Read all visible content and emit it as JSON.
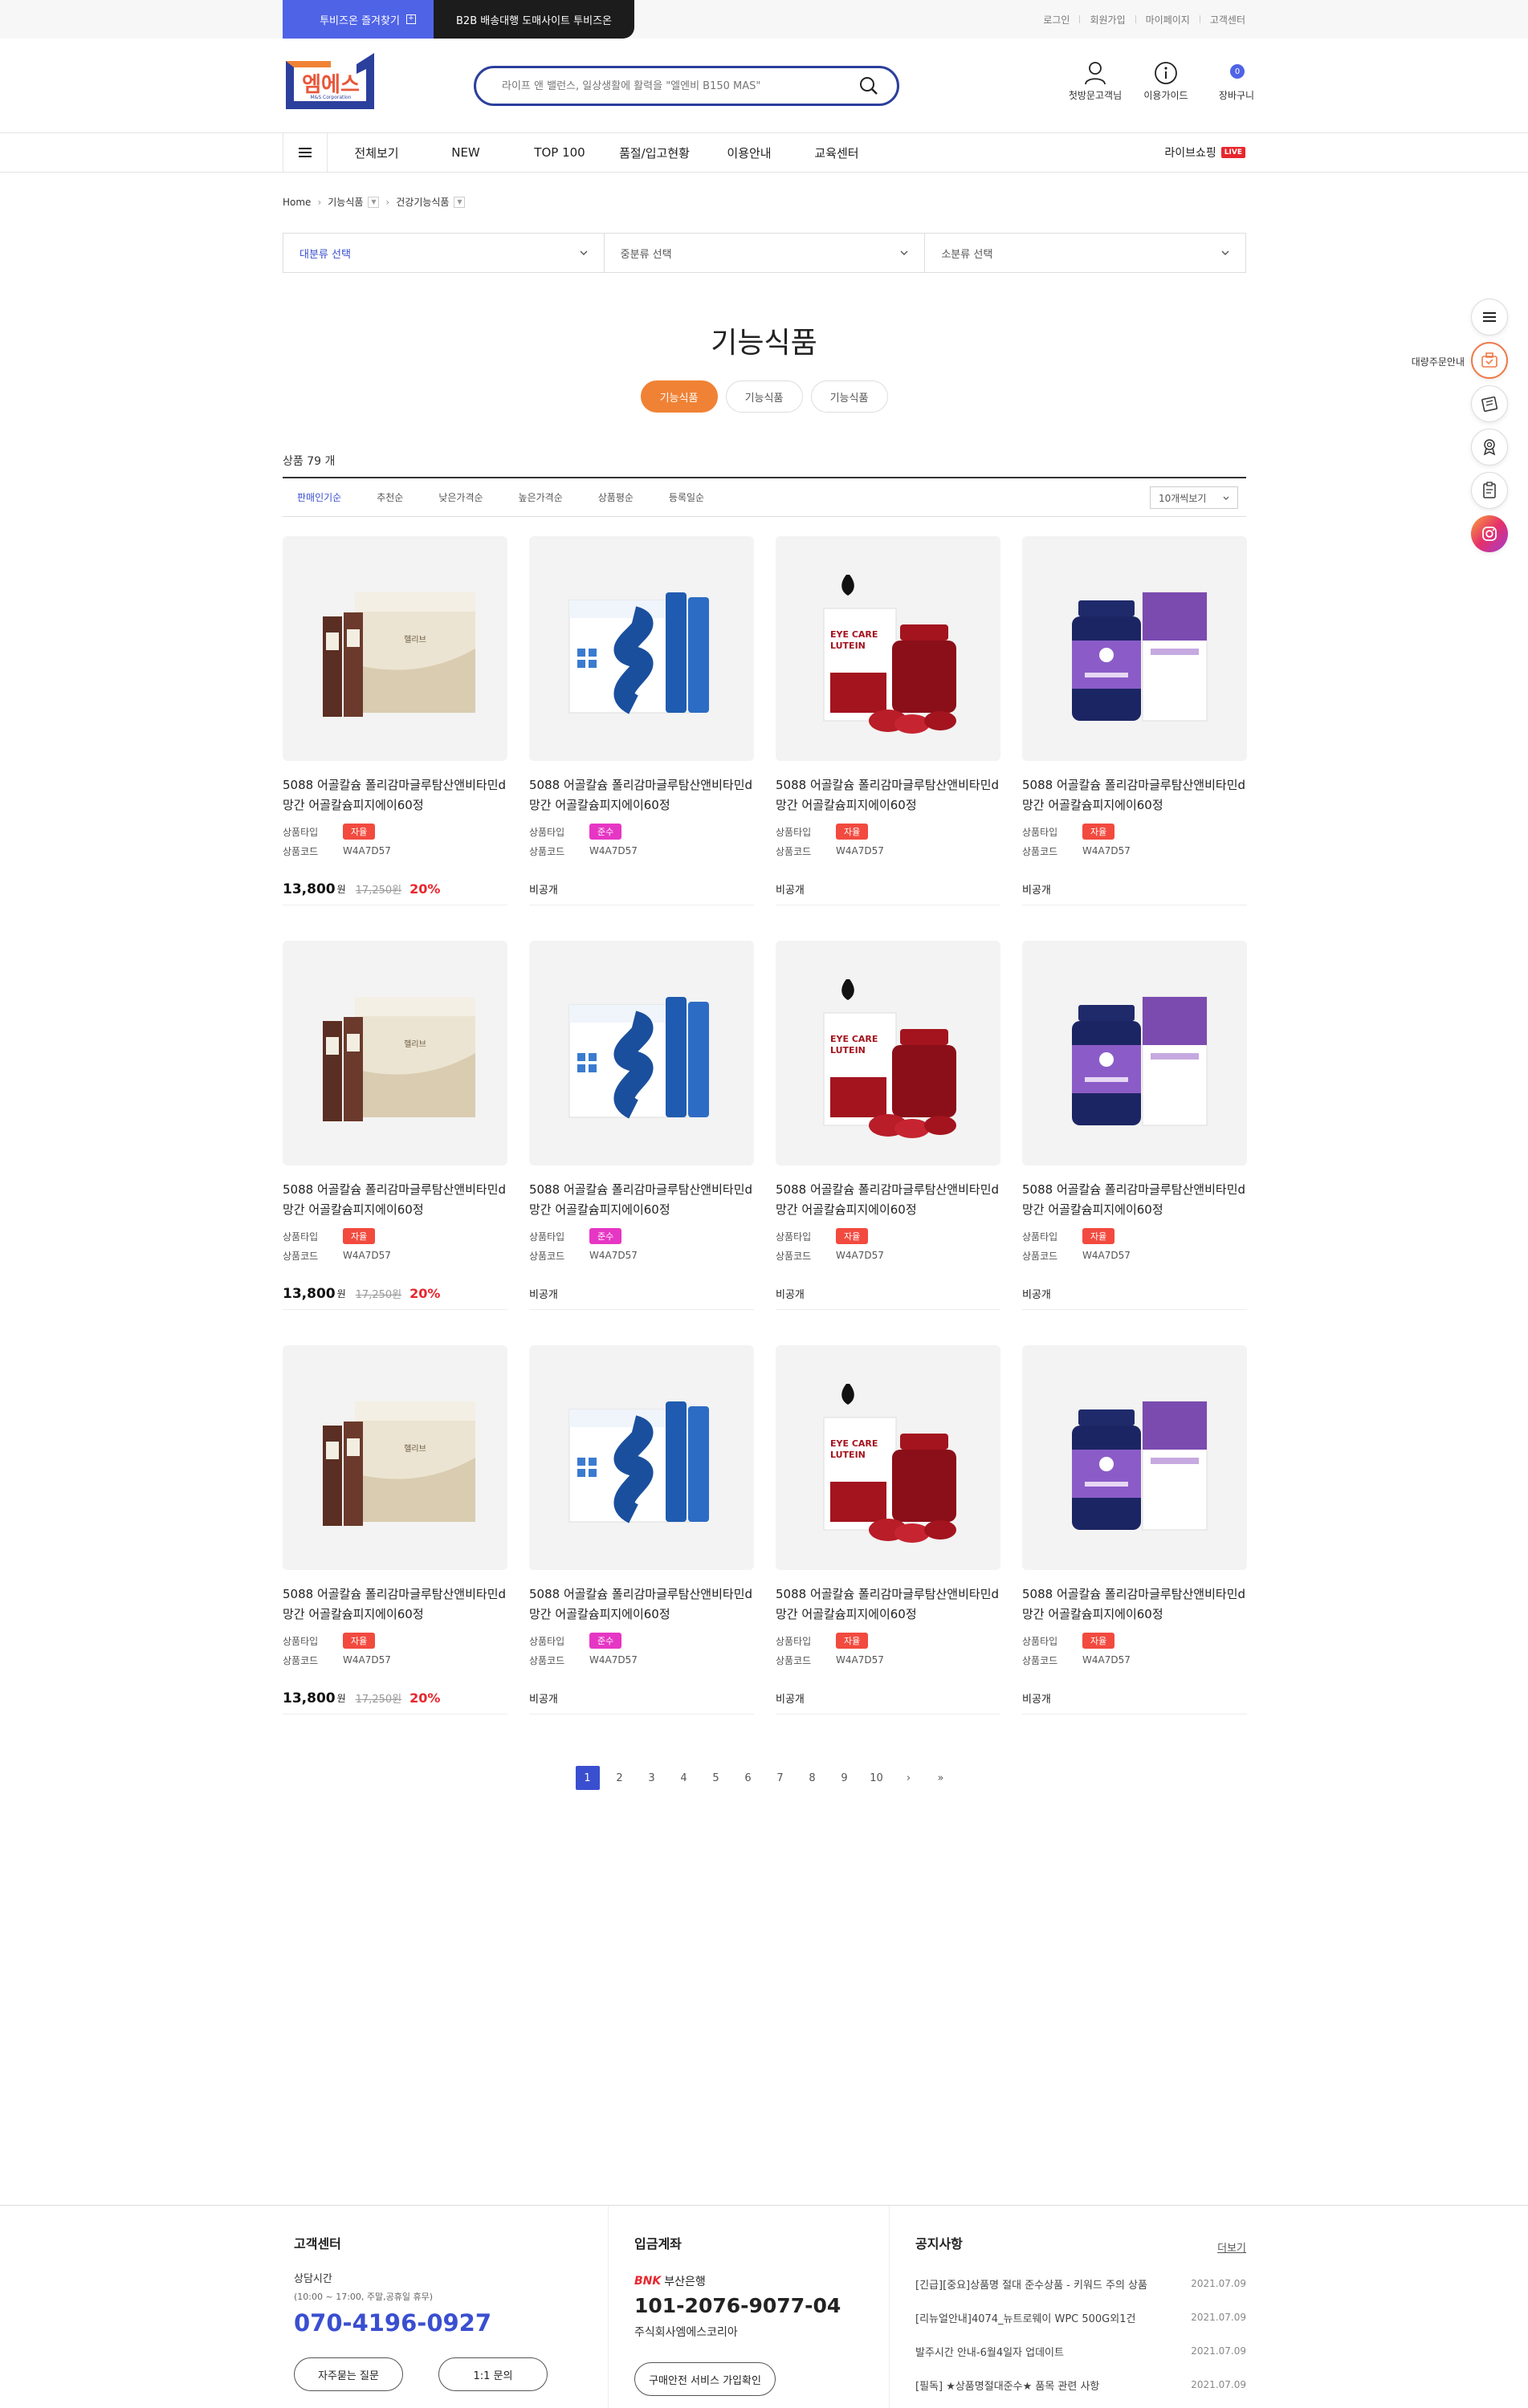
{
  "topbar": {
    "tab_business": "투비즈온 즐겨찾기",
    "tab_b2b": "B2B 배송대행 도매사이트 투비즈온",
    "links": [
      "로그인",
      "회원가입",
      "마이페이지",
      "고객센터"
    ]
  },
  "header": {
    "logo_text": "엠에스",
    "logo_sub": "M&S Corporation",
    "search_placeholder": "라이프 앤 밸런스, 일상생활에 활력을 \"엘엔비 B150 MAS\"",
    "icons": [
      {
        "label": "첫방문고객님",
        "icon": "user-icon"
      },
      {
        "label": "이용가이드",
        "icon": "info-icon"
      },
      {
        "label": "장바구니",
        "icon": "cart-icon",
        "badge": "0"
      }
    ]
  },
  "nav": {
    "items": [
      "전체보기",
      "NEW",
      "TOP 100",
      "품절/입고현황",
      "이용안내",
      "교육센터"
    ],
    "live_label": "라이브쇼핑",
    "live_badge": "LIVE"
  },
  "breadcrumb": {
    "home": "Home",
    "level1": "기능식품",
    "level2": "건강기능식품"
  },
  "filters": [
    "대분류 선택",
    "중분류 선택",
    "소분류 선택"
  ],
  "page": {
    "title": "기능식품",
    "subtabs": [
      "기능식품",
      "기능식품",
      "기능식품"
    ],
    "count_label": "상품 79 개"
  },
  "sort": {
    "options": [
      "판매인기순",
      "추천순",
      "낮은가격순",
      "높은가격순",
      "상품평순",
      "등록일순"
    ],
    "view_select": "10개씩보기"
  },
  "product_labels": {
    "type": "상품타입",
    "code": "상품코드",
    "won": "원"
  },
  "products": [
    {
      "name": "5088 어골칼슘 폴리감마글루탐산앤비타민d 망간 어골칼슘피지에이60정",
      "type": "자율",
      "type_color": "red",
      "code": "W4A7D57",
      "price": "13,800",
      "orig": "17,250원",
      "disc": "20%",
      "image": "stick-box",
      "private": ""
    },
    {
      "name": "5088 어골칼슘 폴리감마글루탐산앤비타민d 망간 어골칼슘피지에이60정",
      "type": "준수",
      "type_color": "pink",
      "code": "W4A7D57",
      "price": "",
      "orig": "",
      "disc": "",
      "image": "probiotics-box",
      "private": "비공개"
    },
    {
      "name": "5088 어골칼슘 폴리감마글루탐산앤비타민d 망간 어골칼슘피지에이60정",
      "type": "자율",
      "type_color": "red",
      "code": "W4A7D57",
      "price": "",
      "orig": "",
      "disc": "",
      "image": "lutein-gummy",
      "private": "비공개"
    },
    {
      "name": "5088 어골칼슘 폴리감마글루탐산앤비타민d 망간 어골칼슘피지에이60정",
      "type": "자율",
      "type_color": "red",
      "code": "W4A7D57",
      "price": "",
      "orig": "",
      "disc": "",
      "image": "purple-bottle",
      "private": "비공개"
    },
    {
      "name": "5088 어골칼슘 폴리감마글루탐산앤비타민d 망간 어골칼슘피지에이60정",
      "type": "자율",
      "type_color": "red",
      "code": "W4A7D57",
      "price": "13,800",
      "orig": "17,250원",
      "disc": "20%",
      "image": "stick-box",
      "private": ""
    },
    {
      "name": "5088 어골칼슘 폴리감마글루탐산앤비타민d 망간 어골칼슘피지에이60정",
      "type": "준수",
      "type_color": "pink",
      "code": "W4A7D57",
      "price": "",
      "orig": "",
      "disc": "",
      "image": "probiotics-box",
      "private": "비공개"
    },
    {
      "name": "5088 어골칼슘 폴리감마글루탐산앤비타민d 망간 어골칼슘피지에이60정",
      "type": "자율",
      "type_color": "red",
      "code": "W4A7D57",
      "price": "",
      "orig": "",
      "disc": "",
      "image": "lutein-gummy",
      "private": "비공개"
    },
    {
      "name": "5088 어골칼슘 폴리감마글루탐산앤비타민d 망간 어골칼슘피지에이60정",
      "type": "자율",
      "type_color": "red",
      "code": "W4A7D57",
      "price": "",
      "orig": "",
      "disc": "",
      "image": "purple-bottle",
      "private": "비공개"
    },
    {
      "name": "5088 어골칼슘 폴리감마글루탐산앤비타민d 망간 어골칼슘피지에이60정",
      "type": "자율",
      "type_color": "red",
      "code": "W4A7D57",
      "price": "13,800",
      "orig": "17,250원",
      "disc": "20%",
      "image": "stick-box",
      "private": ""
    },
    {
      "name": "5088 어골칼슘 폴리감마글루탐산앤비타민d 망간 어골칼슘피지에이60정",
      "type": "준수",
      "type_color": "pink",
      "code": "W4A7D57",
      "price": "",
      "orig": "",
      "disc": "",
      "image": "probiotics-box",
      "private": "비공개"
    },
    {
      "name": "5088 어골칼슘 폴리감마글루탐산앤비타민d 망간 어골칼슘피지에이60정",
      "type": "자율",
      "type_color": "red",
      "code": "W4A7D57",
      "price": "",
      "orig": "",
      "disc": "",
      "image": "lutein-gummy",
      "private": "비공개"
    },
    {
      "name": "5088 어골칼슘 폴리감마글루탐산앤비타민d 망간 어골칼슘피지에이60정",
      "type": "자율",
      "type_color": "red",
      "code": "W4A7D57",
      "price": "",
      "orig": "",
      "disc": "",
      "image": "purple-bottle",
      "private": "비공개"
    }
  ],
  "pagination": {
    "pages": [
      "1",
      "2",
      "3",
      "4",
      "5",
      "6",
      "7",
      "8",
      "9",
      "10"
    ],
    "current": "1",
    "next": "›",
    "last": "»"
  },
  "quick_menu": {
    "label": "대량주문안내",
    "icons": [
      "menu-icon",
      "bulk-order-icon",
      "catalog-icon",
      "award-icon",
      "clipboard-icon",
      "instagram-icon"
    ]
  },
  "footer": {
    "cs_title": "고객센터",
    "hours_label": "상담시간",
    "hours": "(10:00 ~ 17:00, 주말,공휴일 휴무)",
    "phone": "070-4196-0927",
    "btn_faq": "자주묻는 질문",
    "btn_qna": "1:1 문의",
    "bank_title": "입금계좌",
    "bank_logo": "BNK",
    "bank_name": "부산은행",
    "account": "101-2076-9077-04",
    "holder": "주식회사엠에스코리아",
    "btn_safe": "구매안전 서비스 가입확인",
    "notice_title": "공지사항",
    "notice_more": "더보기",
    "notices": [
      {
        "text": "[긴급][중요]상품명 절대 준수상품 - 키워드 주의 상품",
        "date": "2021.07.09"
      },
      {
        "text": "[리뉴얼안내]4074_뉴트로웨이 WPC 500G외1건",
        "date": "2021.07.09"
      },
      {
        "text": "발주시간 안내-6월4일자 업데이트",
        "date": "2021.07.09"
      },
      {
        "text": "[필독] ★상품명절대준수★ 품목 관련 사항",
        "date": "2021.07.09"
      }
    ]
  }
}
